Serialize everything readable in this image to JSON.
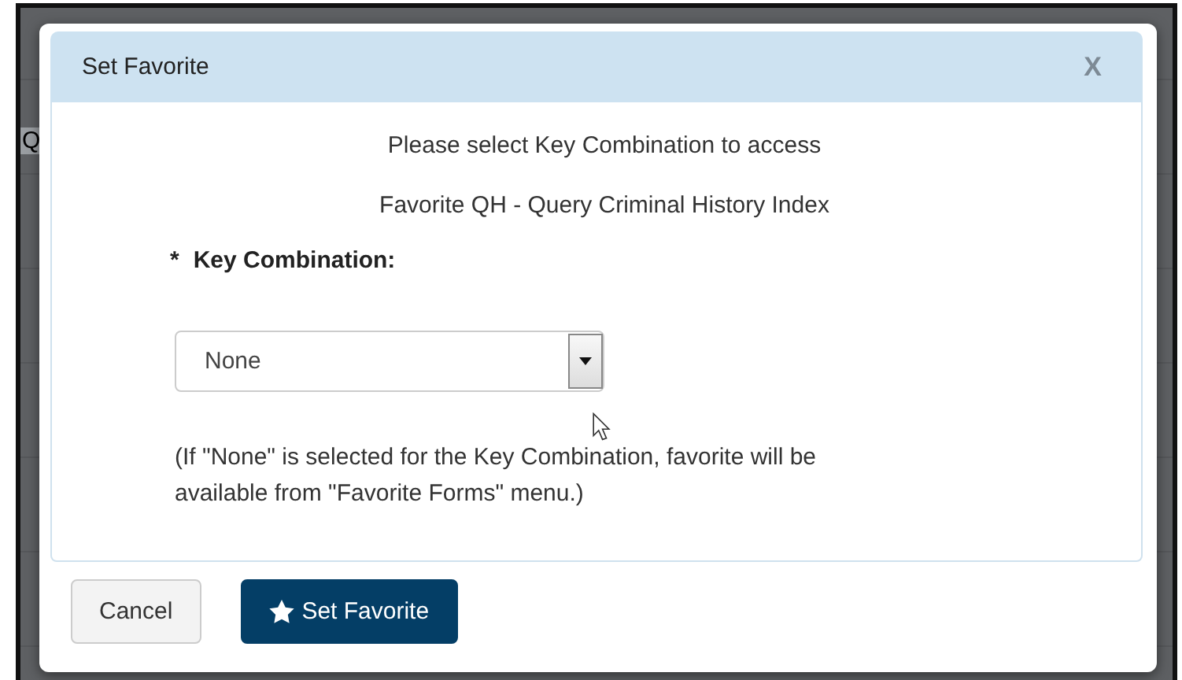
{
  "backdrop": {
    "text": "Q"
  },
  "dialog": {
    "title": "Set Favorite",
    "close": "X",
    "messages": [
      "Please select Key Combination to access",
      "Favorite QH - Query Criminal History Index"
    ],
    "field": {
      "required_mark": "*",
      "label": "Key Combination:",
      "value": "None"
    },
    "note": "(If \"None\" is selected for the Key Combination, favorite will be available from \"Favorite Forms\" menu.)",
    "buttons": [
      {
        "label": "Cancel",
        "kind": "default"
      },
      {
        "label": "Set Favorite",
        "kind": "primary"
      }
    ]
  }
}
